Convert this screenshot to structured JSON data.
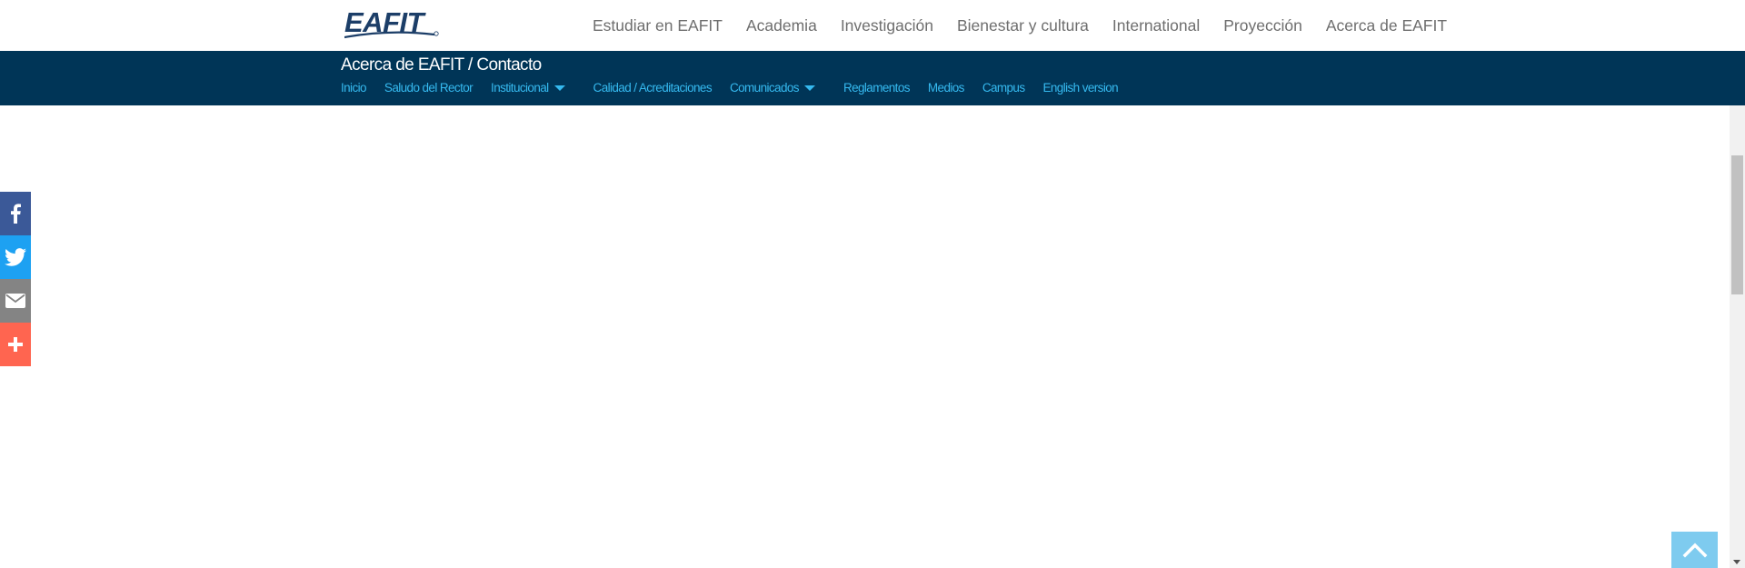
{
  "logo": {
    "text": "EAFIT",
    "icon": "eafit-logo"
  },
  "top_nav": [
    {
      "label": "Estudiar en EAFIT"
    },
    {
      "label": "Academia"
    },
    {
      "label": "Investigación"
    },
    {
      "label": "Bienestar y cultura"
    },
    {
      "label": "International"
    },
    {
      "label": "Proyección"
    },
    {
      "label": "Acerca de EAFIT"
    }
  ],
  "breadcrumb": {
    "title": "Acerca de EAFIT / Contacto"
  },
  "sub_nav": [
    {
      "label": "Inicio"
    },
    {
      "label": "Saludo del Rector"
    },
    {
      "label": "Institucional",
      "dropdown": true
    },
    {
      "label": "Calidad / Acreditaciones"
    },
    {
      "label": "Comunicados",
      "dropdown": true
    },
    {
      "label": "Reglamentos"
    },
    {
      "label": "Medios"
    },
    {
      "label": "Campus"
    },
    {
      "label": "English version"
    }
  ],
  "social": [
    {
      "icon": "facebook-icon",
      "color": "#3b5998"
    },
    {
      "icon": "twitter-icon",
      "color": "#1da1f2"
    },
    {
      "icon": "email-icon",
      "color": "#848484"
    },
    {
      "icon": "plus-icon",
      "color": "#ff6550"
    }
  ],
  "colors": {
    "header_bg": "#003557",
    "link": "#35b9ef",
    "top_nav_text": "#6e6e6e",
    "back_to_top": "#7ecbef"
  },
  "back_to_top": {
    "icon": "chevron-up-icon"
  }
}
